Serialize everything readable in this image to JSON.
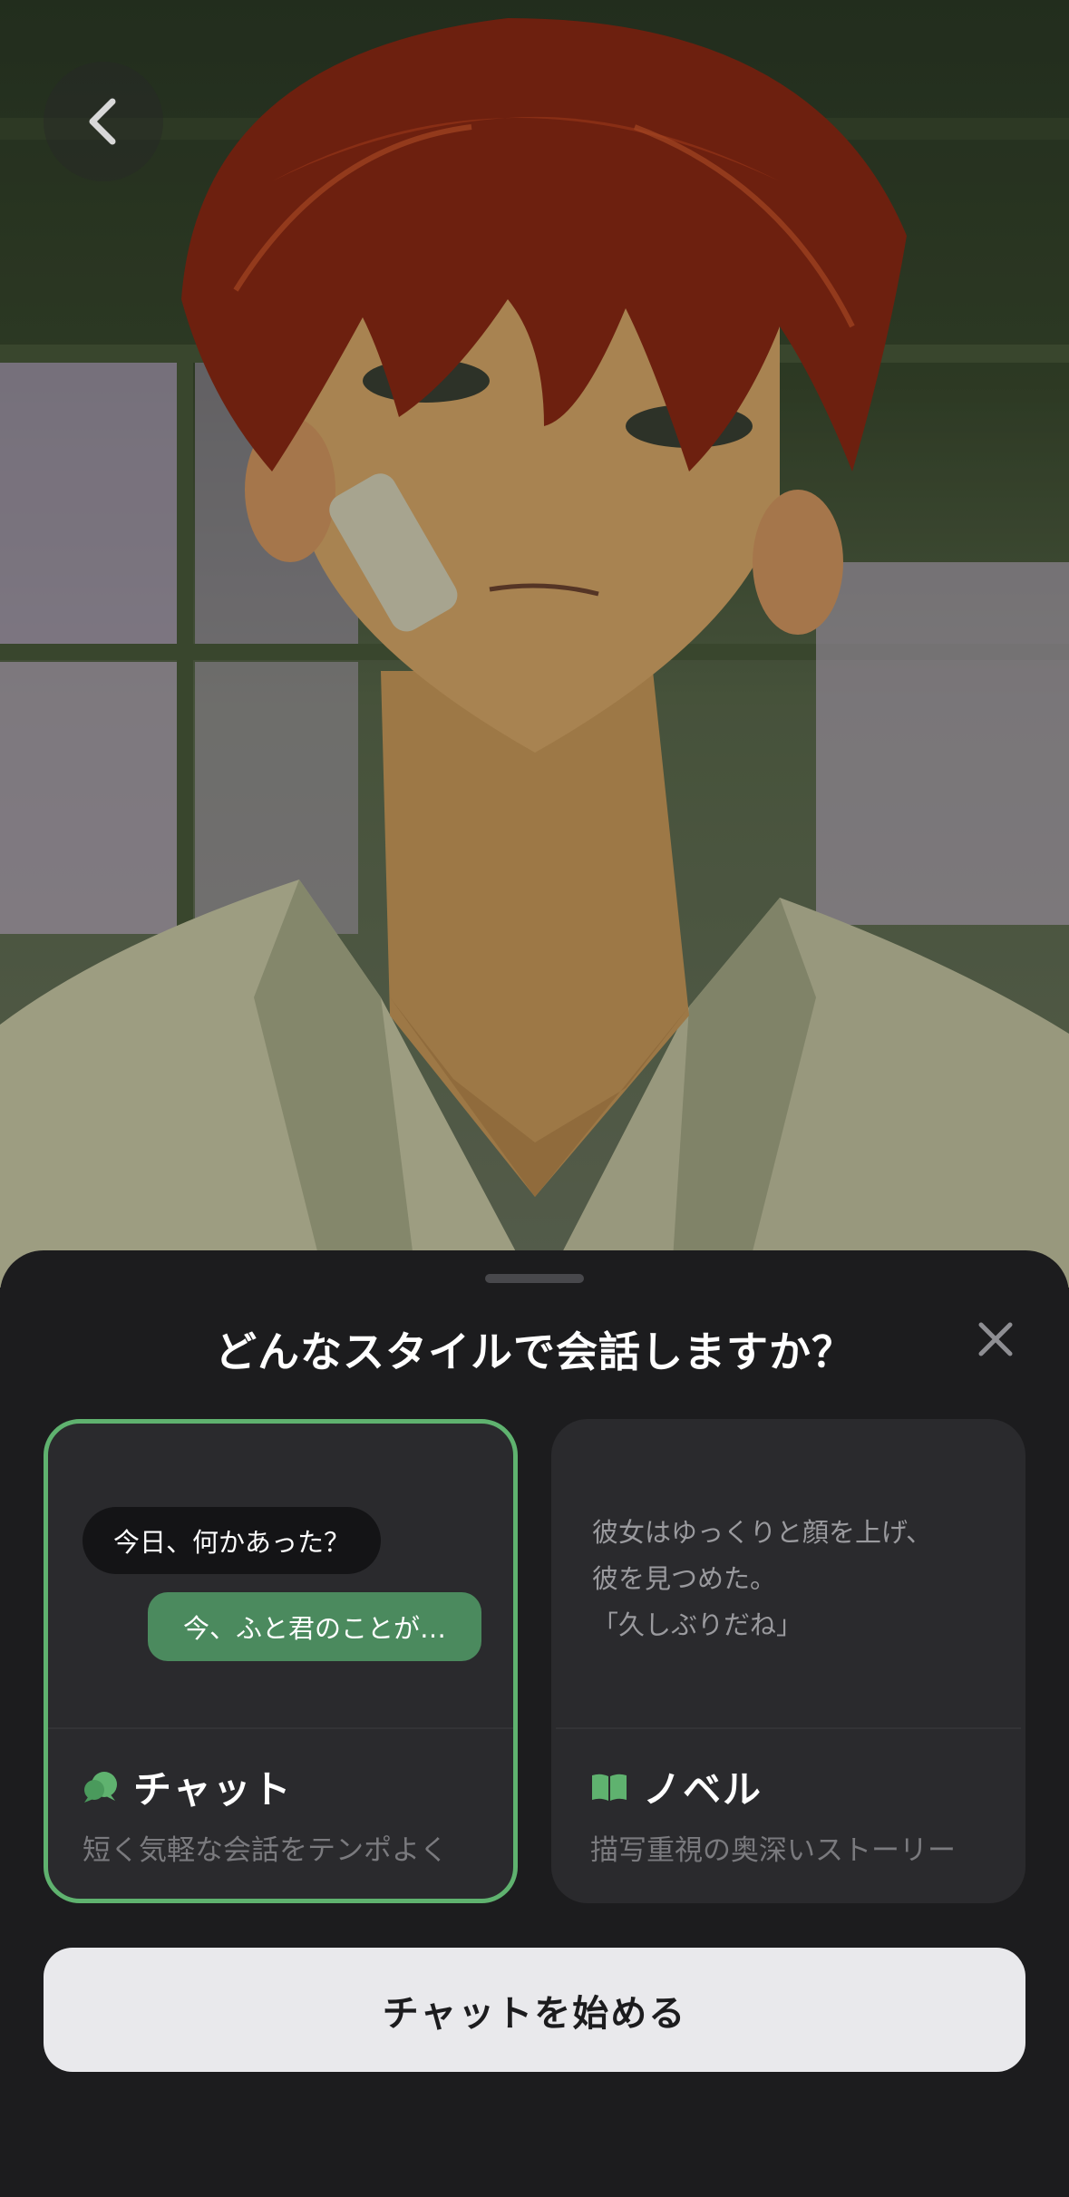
{
  "sheet": {
    "title": "どんなスタイルで会話しますか？"
  },
  "options": {
    "chat": {
      "label": "チャット",
      "description": "短く気軽な会話をテンポよく",
      "preview_user": "今日、何かあった？",
      "preview_reply": "今、ふと君のことが…",
      "selected": true,
      "accent": "#5fb26f"
    },
    "novel": {
      "label": "ノベル",
      "description": "描写重視の奥深いストーリー",
      "preview_lines": [
        "彼女はゆっくりと顔を上げ、",
        "彼を見つめた。",
        "「久しぶりだね」"
      ],
      "selected": false
    }
  },
  "actions": {
    "start_label": "チャットを始める"
  },
  "icons": {
    "back": "chevron-left-icon",
    "close": "close-icon",
    "chat": "chat-bubbles-icon",
    "novel": "open-book-icon"
  }
}
